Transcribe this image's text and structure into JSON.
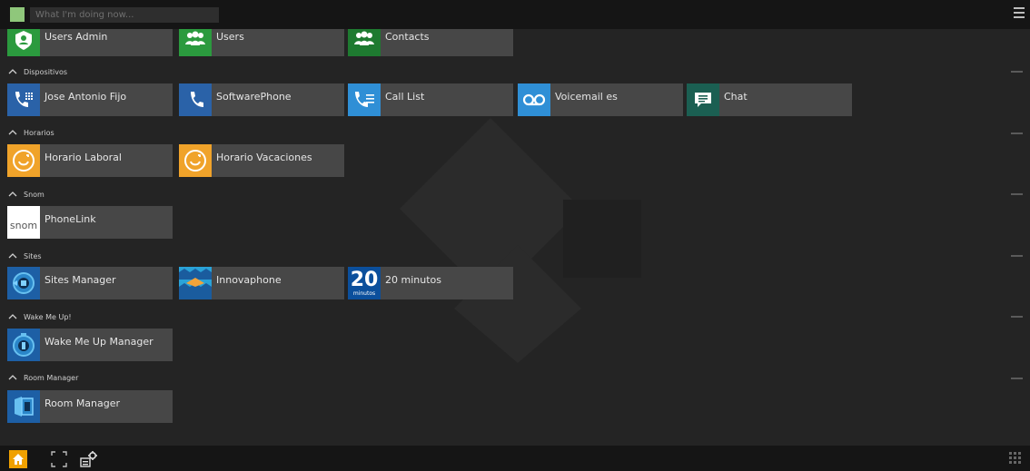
{
  "topbar": {
    "status_placeholder": "What I'm doing now...",
    "presence_color": "#8fc77b",
    "menu_icon": "hamburger-menu-icon"
  },
  "tiles_top": [
    {
      "label": "Users Admin",
      "icon": "users-admin-icon",
      "color": "#2b9a3e"
    },
    {
      "label": "Users",
      "icon": "users-icon",
      "color": "#2b9a3e"
    },
    {
      "label": "Contacts",
      "icon": "contacts-icon",
      "color": "#1e7a30"
    }
  ],
  "sections": [
    {
      "title": "Dispositivos",
      "apps": [
        {
          "label": "Jose Antonio Fijo",
          "icon": "phone-keypad-icon",
          "color": "#2a62a8"
        },
        {
          "label": "SoftwarePhone",
          "icon": "phone-icon",
          "color": "#2a62a8"
        },
        {
          "label": "Call List",
          "icon": "call-list-icon",
          "color": "#2f8fd6"
        },
        {
          "label": "Voicemail es",
          "icon": "voicemail-icon",
          "color": "#2f8fd6"
        },
        {
          "label": "Chat",
          "icon": "chat-icon",
          "color": "#1b5f52"
        }
      ]
    },
    {
      "title": "Horarios",
      "apps": [
        {
          "label": "Horario Laboral",
          "icon": "clock-icon",
          "color": "#f0a32a"
        },
        {
          "label": "Horario Vacaciones",
          "icon": "clock-icon",
          "color": "#f0a32a"
        }
      ]
    },
    {
      "title": "Snom",
      "apps": [
        {
          "label": "PhoneLink",
          "icon": "snom-logo-icon",
          "icon_text": "snom",
          "color": "#ffffff"
        }
      ]
    },
    {
      "title": "Sites",
      "apps": [
        {
          "label": "Sites Manager",
          "icon": "sites-manager-icon",
          "color": "#1d5fa5"
        },
        {
          "label": "Innovaphone",
          "icon": "innovaphone-icon",
          "color": "#2aa3d8"
        },
        {
          "label": "20 minutos",
          "icon": "20minutos-icon",
          "icon_text": "20",
          "icon_subtext": "minutos",
          "color": "#0b4f9c"
        }
      ]
    },
    {
      "title": "Wake Me Up!",
      "apps": [
        {
          "label": "Wake Me Up Manager",
          "icon": "alarm-icon",
          "color": "#1d5fa5"
        }
      ]
    },
    {
      "title": "Room Manager",
      "apps": [
        {
          "label": "Room Manager",
          "icon": "room-icon",
          "color": "#1d5fa5"
        }
      ]
    }
  ],
  "bottombar": {
    "home_icon": "home-icon",
    "fullscreen_icon": "fullscreen-icon",
    "settings_icon": "settings-icon",
    "grid_icon": "grid-icon",
    "accent": "#f0a100"
  }
}
